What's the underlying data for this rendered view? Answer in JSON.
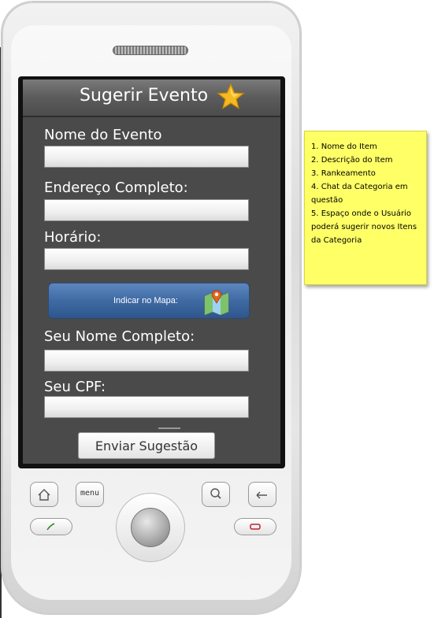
{
  "screen": {
    "title": "Sugerir Evento",
    "fields": [
      {
        "label": "Nome do Evento",
        "value": ""
      },
      {
        "label": "Endereço Completo:",
        "value": ""
      },
      {
        "label": "Horário:",
        "value": ""
      },
      {
        "label": "Seu Nome Completo:",
        "value": ""
      },
      {
        "label": "Seu CPF:",
        "value": ""
      }
    ],
    "map_button_label": "Indicar no Mapa:",
    "submit_label": "Enviar Sugestão"
  },
  "hardware": {
    "menu_label": "menu"
  },
  "note": {
    "lines": [
      "1. Nome do Item",
      "2. Descrição do Item",
      "3. Rankeamento",
      "4. Chat da Categoria em questão",
      "5. Espaço onde o Usuário poderá sugerir novos Itens da Categoria"
    ]
  },
  "colors": {
    "screen_bg": "#4a4a4a",
    "map_button": "#3f6aa3",
    "note_bg": "#ffff66",
    "star": "#f5b921"
  },
  "icons": {
    "title": "star-icon",
    "map": "map-pin-icon",
    "home": "home-icon",
    "search": "search-icon",
    "back": "back-arrow-icon",
    "call": "call-icon",
    "end_call": "end-call-icon"
  }
}
